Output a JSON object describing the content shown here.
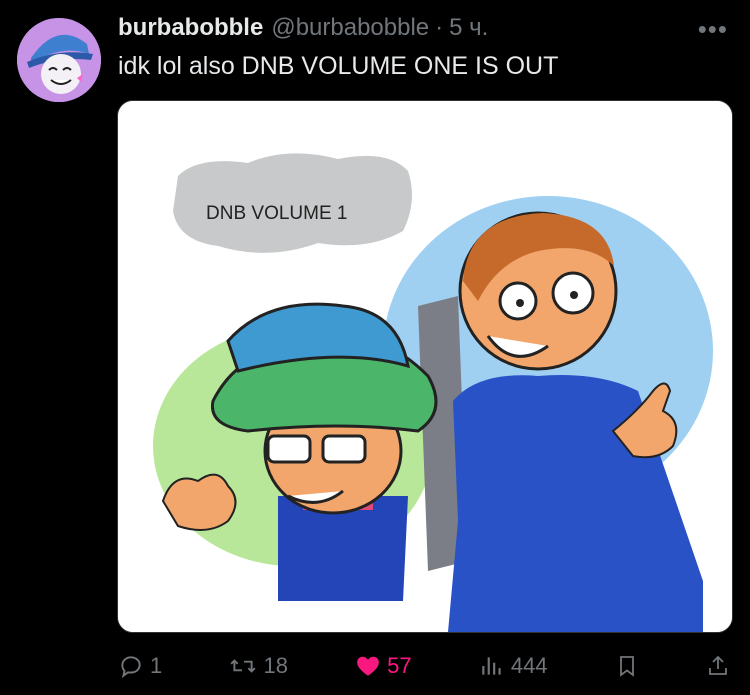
{
  "tweet": {
    "author_name": "burbabobble",
    "author_handle": "@burbabobble",
    "separator": "·",
    "time": "5 ч.",
    "more": "•••",
    "text": "idk lol also DNB VOLUME ONE IS OUT",
    "image_caption": "DNB VOLUME 1"
  },
  "actions": {
    "replies": "1",
    "reposts": "18",
    "likes": "57",
    "views": "444"
  },
  "colors": {
    "like": "#f91880",
    "muted": "#71767b",
    "text": "#e7e9ea"
  }
}
